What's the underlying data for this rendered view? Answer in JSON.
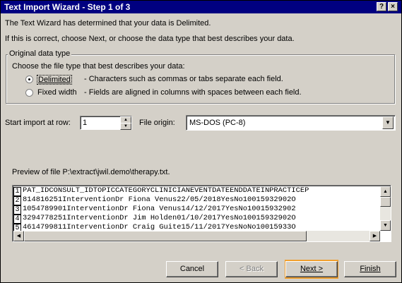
{
  "window": {
    "title": "Text Import Wizard - Step 1 of 3",
    "controls": {
      "help": "?",
      "close": "×"
    }
  },
  "intro": {
    "line1": "The Text Wizard has determined that your data is Delimited.",
    "line2": "If this is correct, choose Next, or choose the data type that best describes your data."
  },
  "original_type": {
    "legend": "Original data type",
    "prompt": "Choose the file type that best describes your data:",
    "options": [
      {
        "label": "Delimited",
        "description": "- Characters such as commas or tabs separate each field.",
        "selected": true
      },
      {
        "label": "Fixed width",
        "description": "- Fields are aligned in columns with spaces between each field.",
        "selected": false
      }
    ]
  },
  "import_settings": {
    "start_row_label": "Start import at row:",
    "start_row_value": "1",
    "file_origin_label": "File origin:",
    "file_origin_value": "MS-DOS (PC-8)"
  },
  "preview": {
    "label": "Preview of file P:\\extract\\jwil.demo\\therapy.txt.",
    "rows": [
      {
        "num": "1",
        "text": "PAT_IDCONSULT_IDTOPICCATEGORYCLINICIANEVENTDATEENDDATEINPRACTICEP"
      },
      {
        "num": "2",
        "text": "814816251InterventionDr Fiona Venus22/05/2018YesNo10015932902O"
      },
      {
        "num": "3",
        "text": "1054789901InterventionDr Fiona Venus14/12/2017YesNo10015932902"
      },
      {
        "num": "4",
        "text": "3294778251InterventionDr Jim Holden01/10/2017YesNo10015932902O"
      },
      {
        "num": "5",
        "text": "4614799811InterventionDr Craig Guite15/11/2017YesNoNo10015933O"
      }
    ]
  },
  "buttons": {
    "cancel": "Cancel",
    "back": "< Back",
    "next": "Next >",
    "finish": "Finish"
  },
  "colors": {
    "titlebar": "#000080",
    "dialog_bg": "#d4d0c8",
    "next_highlight": "#f0a030"
  }
}
